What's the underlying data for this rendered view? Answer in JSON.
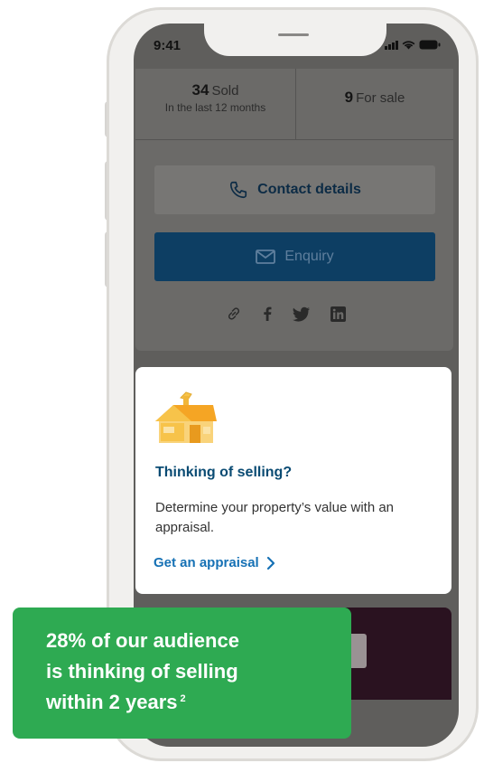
{
  "status_bar": {
    "time": "9:41",
    "icons": [
      "signal-icon",
      "wifi-icon",
      "battery-icon"
    ]
  },
  "stats": {
    "sold": {
      "count": "34",
      "label": "Sold",
      "sublabel": "In the last 12 months"
    },
    "for_sale": {
      "count": "9",
      "label": "For sale"
    }
  },
  "actions": {
    "contact_label": "Contact details",
    "enquiry_label": "Enquiry",
    "share_icons": [
      "link-icon",
      "facebook-icon",
      "twitter-icon",
      "linkedin-icon"
    ]
  },
  "appraisal": {
    "illustration": "house-icon",
    "title": "Thinking of selling?",
    "description": "Determine your property’s value with an appraisal.",
    "link_label": "Get an appraisal"
  },
  "callout": {
    "lines": [
      "28% of our audience",
      "is thinking of selling",
      "within 2 years"
    ],
    "footnote": "2"
  },
  "colors": {
    "callout_green": "#2eaa52",
    "link_blue": "#1671b5",
    "title_navy": "#0a4b73",
    "enquiry_navy": "#0d3e63",
    "house_yellow": "#f7c34a"
  }
}
